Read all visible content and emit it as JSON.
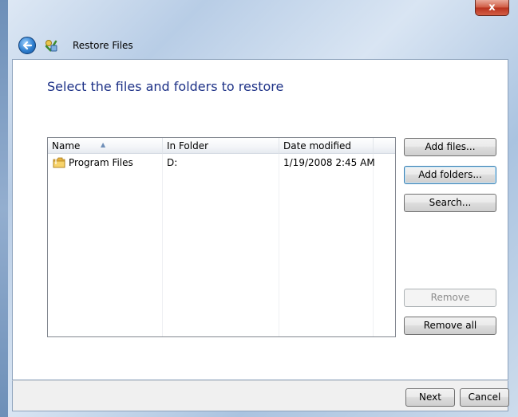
{
  "window": {
    "title": "Restore Files",
    "close_label": "x",
    "back_icon": "back-arrow-icon",
    "app_icon": "restore-files-icon"
  },
  "main": {
    "heading": "Select the files and folders to restore",
    "columns": [
      "Name",
      "In Folder",
      "Date modified"
    ],
    "rows": [
      {
        "name": "Program Files",
        "folder": "D:",
        "date_modified": "1/19/2008 2:45 AM",
        "icon": "folder-icon"
      }
    ]
  },
  "buttons": {
    "add_files": "Add files...",
    "add_folders": "Add folders...",
    "search": "Search...",
    "remove": "Remove",
    "remove_all": "Remove all"
  },
  "footer": {
    "next": "Next",
    "cancel": "Cancel"
  },
  "colors": {
    "heading": "#1e3287",
    "focus_border": "#3c7fb1",
    "close_button": "#c44a33"
  }
}
